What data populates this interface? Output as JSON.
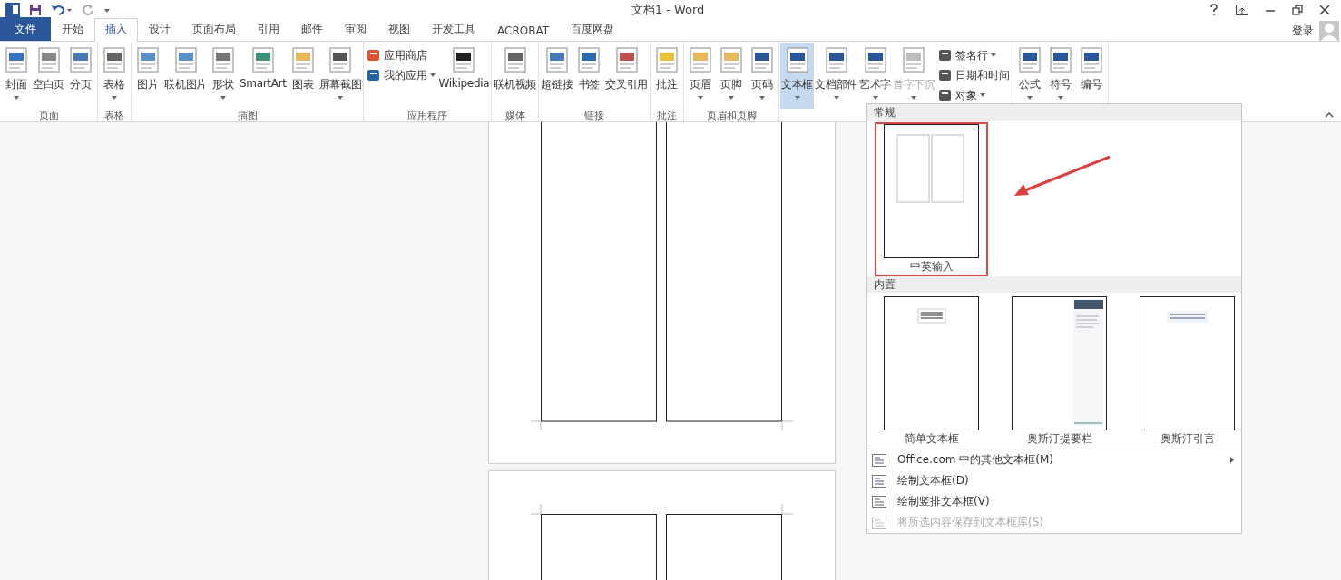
{
  "window": {
    "title": "文档1 - Word"
  },
  "tabs": [
    {
      "label": "文件",
      "kind": "file",
      "selected": false
    },
    {
      "label": "开始",
      "kind": "tab",
      "selected": false
    },
    {
      "label": "插入",
      "kind": "tab",
      "selected": true
    },
    {
      "label": "设计",
      "kind": "tab",
      "selected": false
    },
    {
      "label": "页面布局",
      "kind": "tab",
      "selected": false
    },
    {
      "label": "引用",
      "kind": "tab",
      "selected": false
    },
    {
      "label": "邮件",
      "kind": "tab",
      "selected": false
    },
    {
      "label": "审阅",
      "kind": "tab",
      "selected": false
    },
    {
      "label": "视图",
      "kind": "tab",
      "selected": false
    },
    {
      "label": "开发工具",
      "kind": "tab",
      "selected": false
    },
    {
      "label": "ACROBAT",
      "kind": "tab",
      "selected": false
    },
    {
      "label": "百度网盘",
      "kind": "tab",
      "selected": false
    }
  ],
  "account": {
    "label": "登录"
  },
  "ribbon": {
    "groups": [
      {
        "label": "页面",
        "items": [
          {
            "kind": "large",
            "label": "封面",
            "has_menu": true
          },
          {
            "kind": "large",
            "label": "空白页",
            "has_menu": false
          },
          {
            "kind": "large",
            "label": "分页",
            "has_menu": false
          }
        ]
      },
      {
        "label": "表格",
        "items": [
          {
            "kind": "large",
            "label": "表格",
            "has_menu": true
          }
        ]
      },
      {
        "label": "插图",
        "items": [
          {
            "kind": "large",
            "label": "图片",
            "has_menu": false
          },
          {
            "kind": "large",
            "label": "联机图片",
            "has_menu": false
          },
          {
            "kind": "large",
            "label": "形状",
            "has_menu": true
          },
          {
            "kind": "large",
            "label": "SmartArt",
            "has_menu": false
          },
          {
            "kind": "large",
            "label": "图表",
            "has_menu": false
          },
          {
            "kind": "large",
            "label": "屏幕截图",
            "has_menu": true
          }
        ]
      },
      {
        "label": "应用程序",
        "items": [
          {
            "kind": "small",
            "label": "应用商店",
            "has_menu": false
          },
          {
            "kind": "small",
            "label": "我的应用",
            "has_menu": true
          },
          {
            "kind": "large",
            "label": "Wikipedia",
            "has_menu": false
          }
        ]
      },
      {
        "label": "媒体",
        "items": [
          {
            "kind": "large",
            "label": "联机视频",
            "has_menu": false
          }
        ]
      },
      {
        "label": "链接",
        "items": [
          {
            "kind": "large",
            "label": "超链接",
            "has_menu": false
          },
          {
            "kind": "large",
            "label": "书签",
            "has_menu": false
          },
          {
            "kind": "large",
            "label": "交叉引用",
            "has_menu": false
          }
        ]
      },
      {
        "label": "批注",
        "items": [
          {
            "kind": "large",
            "label": "批注",
            "has_menu": false
          }
        ]
      },
      {
        "label": "页眉和页脚",
        "items": [
          {
            "kind": "large",
            "label": "页眉",
            "has_menu": true
          },
          {
            "kind": "large",
            "label": "页脚",
            "has_menu": true
          },
          {
            "kind": "large",
            "label": "页码",
            "has_menu": true
          }
        ]
      },
      {
        "items": [
          {
            "kind": "large",
            "label": "文本框",
            "has_menu": true,
            "selected": true
          },
          {
            "kind": "large",
            "label": "文档部件",
            "has_menu": true,
            "selected": false
          },
          {
            "kind": "large",
            "label": "艺术字",
            "has_menu": true,
            "selected": false
          },
          {
            "kind": "large",
            "label": "首字下沉",
            "has_menu": true,
            "selected": false,
            "disabled": true
          },
          {
            "kind": "small",
            "label": "签名行",
            "has_menu": true
          },
          {
            "kind": "small",
            "label": "日期和时间",
            "has_menu": false
          },
          {
            "kind": "small",
            "label": "对象",
            "has_menu": true
          }
        ]
      },
      {
        "items": [
          {
            "kind": "large",
            "label": "公式",
            "has_menu": true
          },
          {
            "kind": "large",
            "label": "符号",
            "has_menu": true
          },
          {
            "kind": "large",
            "label": "编号",
            "has_menu": false
          }
        ]
      }
    ]
  },
  "textbox_menu": {
    "sections": [
      {
        "title": "常规",
        "items": [
          {
            "label": "中英输入",
            "highlighted": true
          }
        ]
      },
      {
        "title": "内置",
        "items": [
          {
            "label": "简单文本框",
            "highlighted": false
          },
          {
            "label": "奥斯汀提要栏",
            "highlighted": false
          },
          {
            "label": "奥斯汀引言",
            "highlighted": false
          }
        ]
      }
    ],
    "commands": [
      {
        "label": "Office.com 中的其他文本框(M)",
        "submenu": true,
        "disabled": false
      },
      {
        "label": "绘制文本框(D)",
        "submenu": false,
        "disabled": false
      },
      {
        "label": "绘制竖排文本框(V)",
        "submenu": false,
        "disabled": false
      },
      {
        "label": "将所选内容保存到文本框库(S)",
        "submenu": false,
        "disabled": true
      }
    ]
  }
}
